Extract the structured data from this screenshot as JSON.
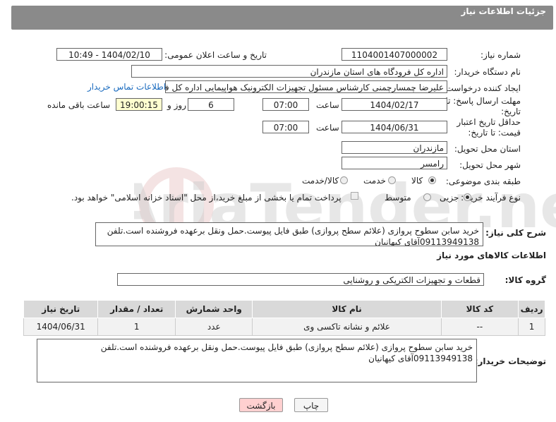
{
  "header": {
    "title": "جزئیات اطلاعات نیاز"
  },
  "fields": {
    "need_number_label": "شماره نیاز:",
    "need_number": "1104001407000002",
    "announce_label": "تاریخ و ساعت اعلان عمومی:",
    "announce_value": "1404/02/10 - 10:49",
    "buyer_org_label": "نام دستگاه خریدار:",
    "buyer_org": "اداره کل فرودگاه های استان مازندران",
    "creator_label": "ایجاد کننده درخواست:",
    "creator": "علیرضا چمسارچمنی کارشناس مسئول تجهیزات الکترونیک هواپیمایی اداره کل فرودگاه",
    "contact_link": "اطلاعات تماس خریدار",
    "reply_deadline_label": "مهلت ارسال پاسخ: تا تاریخ:",
    "reply_date": "1404/02/17",
    "time_label": "ساعت",
    "reply_time": "07:00",
    "days_value": "6",
    "days_label": "روز و",
    "remaining_time": "19:00:15",
    "remaining_label": "ساعت باقی مانده",
    "price_deadline_label": "حداقل تاریخ اعتبار قیمت: تا تاریخ:",
    "price_date": "1404/06/31",
    "price_time": "07:00",
    "province_label": "استان محل تحویل:",
    "province": "مازندران",
    "city_label": "شهر محل تحویل:",
    "city": "رامسر",
    "category_label": "طبقه بندی موضوعی:",
    "category_options": [
      "کالا",
      "خدمت",
      "کالا/خدمت"
    ],
    "process_label": "نوع فرآیند خرید :",
    "process_options": [
      "جزیی",
      "متوسط"
    ],
    "payment_note": "پرداخت تمام یا بخشی از مبلغ خرید،از محل \"اسناد خزانه اسلامی\" خواهد بود.",
    "description_label": "شرح کلی نیاز:",
    "description": "خرید سابن سطوح پروازی (علائم سطح پروازی) طبق فایل پیوست.حمل ونقل برعهده فروشنده است.تلفن 09113949138آقای کیهانیان"
  },
  "goods": {
    "section_title": "اطلاعات کالاهای مورد نیاز",
    "group_label": "گروه کالا:",
    "group_value": "قطعات و تجهیزات الکتریکی و روشنایی",
    "columns": [
      "ردیف",
      "کد کالا",
      "نام کالا",
      "واحد شمارش",
      "تعداد / مقدار",
      "تاریخ نیاز"
    ],
    "rows": [
      [
        "1",
        "--",
        "علائم و نشانه تاکسی وی",
        "عدد",
        "1",
        "1404/06/31"
      ]
    ]
  },
  "buyer_notes": {
    "label": "توضیحات خریدار:",
    "text": "خرید سابن سطوح پروازی (علائم سطح پروازی) طبق فایل پیوست.حمل ونقل برعهده فروشنده است.تلفن 09113949138آقای کیهانیان"
  },
  "buttons": {
    "print": "چاپ",
    "back": "بازگشت"
  },
  "watermark_text": "AriaTender.neT"
}
